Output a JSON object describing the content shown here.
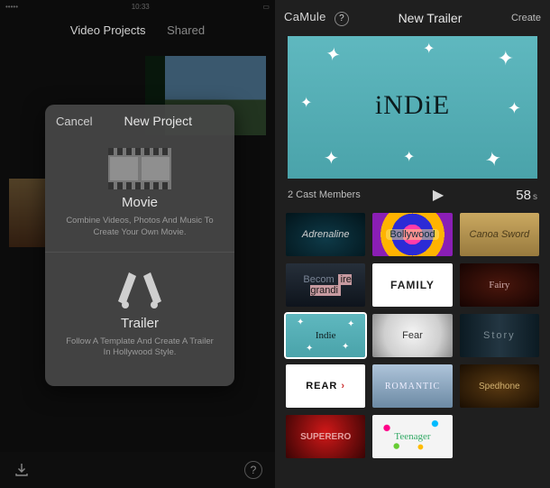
{
  "left": {
    "status": {
      "carrier": "•••••",
      "time": "10:33"
    },
    "tabs": {
      "projects": "Video Projects",
      "shared": "Shared"
    },
    "modal": {
      "cancel": "Cancel",
      "title": "New Project",
      "movie": {
        "label": "Movie",
        "desc": "Combine Videos, Photos And Music To Create Your Own Movie."
      },
      "trailer": {
        "label": "Trailer",
        "desc": "Follow A Template And Create A Trailer In Hollywood Style."
      }
    },
    "help_glyph": "?"
  },
  "right": {
    "header": {
      "brand_a": "Ca",
      "brand_b": "Mule",
      "help_glyph": "?",
      "title": "New Trailer",
      "create": "Create"
    },
    "preview": {
      "title": "iNDiE"
    },
    "meta": {
      "cast": "2 Cast Members",
      "play_glyph": "▶",
      "duration_value": "58",
      "duration_unit": "s"
    },
    "templates": [
      {
        "id": "adrenaline",
        "label": "Adrenaline"
      },
      {
        "id": "bollywood",
        "label": "Bollywood"
      },
      {
        "id": "canoa",
        "label": "Canoa Sword"
      },
      {
        "id": "become",
        "label_pre": "Becom",
        "label_hl": "ire grandi"
      },
      {
        "id": "family",
        "label": "FAMILY"
      },
      {
        "id": "fairy",
        "label": "Fairy"
      },
      {
        "id": "indie",
        "label": "Indie",
        "selected": true
      },
      {
        "id": "fear",
        "label": "Fear"
      },
      {
        "id": "story",
        "label": "Story"
      },
      {
        "id": "rear",
        "label": "REAR"
      },
      {
        "id": "romantic",
        "label": "ROMANTIC"
      },
      {
        "id": "spedhone",
        "label": "Spedhone"
      },
      {
        "id": "superhero",
        "label": "SUPERERO"
      },
      {
        "id": "teenager",
        "label": "Teenager"
      }
    ]
  }
}
